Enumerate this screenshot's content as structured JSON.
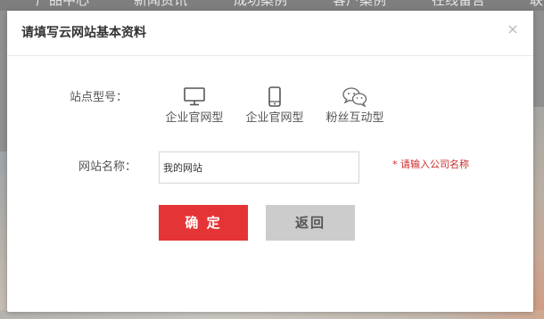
{
  "background_nav": {
    "items": [
      "产品中心",
      "新闻资讯",
      "成功案例",
      "客户案例",
      "在线留言",
      "联"
    ]
  },
  "dialog": {
    "title": "请填写云网站基本资料",
    "close_symbol": "×",
    "site_type": {
      "label": "站点型号：",
      "options": [
        {
          "label": "企业官网型",
          "icon": "desktop-icon"
        },
        {
          "label": "企业官网型",
          "icon": "mobile-phone-icon"
        },
        {
          "label": "粉丝互动型",
          "icon": "wechat-icon"
        }
      ]
    },
    "site_name": {
      "label": "网站名称：",
      "value": "我的网站",
      "hint": "* 请输入公司名称"
    },
    "buttons": {
      "confirm": "确 定",
      "back": "返回"
    }
  },
  "colors": {
    "accent_red": "#e53435",
    "hint_red": "#cc2b2b",
    "secondary_gray": "#cccccc",
    "overlay_gray": "#8f8f8f"
  }
}
